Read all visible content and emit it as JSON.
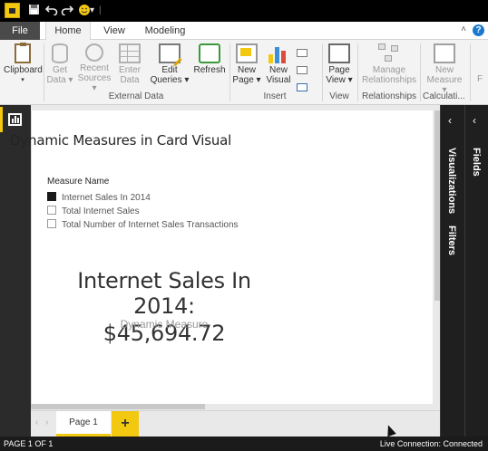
{
  "quick_access": {
    "save_icon": "save-icon",
    "undo_icon": "undo-icon",
    "redo_icon": "redo-icon",
    "smiley_icon": "smiley-icon",
    "dropdown": "▾",
    "separator": "|"
  },
  "tabs": {
    "file": "File",
    "home": "Home",
    "view": "View",
    "modeling": "Modeling",
    "collapse": "˄",
    "help": "?"
  },
  "ribbon": {
    "clipboard": {
      "label": "Clipboard",
      "caret": "▾"
    },
    "get_data": {
      "line1": "Get",
      "line2": "Data ▾"
    },
    "recent_sources": {
      "line1": "Recent",
      "line2": "Sources ▾"
    },
    "enter_data": {
      "line1": "Enter",
      "line2": "Data"
    },
    "edit_queries": {
      "line1": "Edit",
      "line2": "Queries ▾"
    },
    "refresh": {
      "label": "Refresh"
    },
    "new_page": {
      "line1": "New",
      "line2": "Page ▾"
    },
    "new_visual": {
      "line1": "New",
      "line2": "Visual"
    },
    "page_view": {
      "line1": "Page",
      "line2": "View ▾"
    },
    "manage_relationships": {
      "line1": "Manage",
      "line2": "Relationships"
    },
    "new_measure": {
      "line1": "New",
      "line2": "Measure ▾"
    },
    "cut_label": "F",
    "groups": {
      "external_data": "External Data",
      "insert": "Insert",
      "view": "View",
      "relationships": "Relationships",
      "calculations": "Calculati..."
    }
  },
  "canvas": {
    "visual_title": "Dynamic Measures in Card Visual",
    "slicer": {
      "title": "Measure Name",
      "items": [
        {
          "label": "Internet Sales In 2014",
          "checked": true
        },
        {
          "label": "Total Internet Sales",
          "checked": false
        },
        {
          "label": "Total Number of Internet Sales Transactions",
          "checked": false
        }
      ]
    },
    "card": {
      "title_line": "Internet Sales In 2014:",
      "value_line": "$45,694.72",
      "label": "Dynamic Measure"
    }
  },
  "pages": {
    "prev": "‹",
    "next": "›",
    "tabs": [
      "Page 1"
    ],
    "add": "+"
  },
  "panes": {
    "visualizations": "Visualizations",
    "filters": "Filters",
    "fields": "Fields",
    "collapse": "‹"
  },
  "status": {
    "page_info": "PAGE 1 OF 1",
    "connection": "Live Connection: Connected"
  },
  "colors": {
    "accent": "#f2c811",
    "dark": "#1f1f1f",
    "ribbon": "#f3f3f3"
  }
}
